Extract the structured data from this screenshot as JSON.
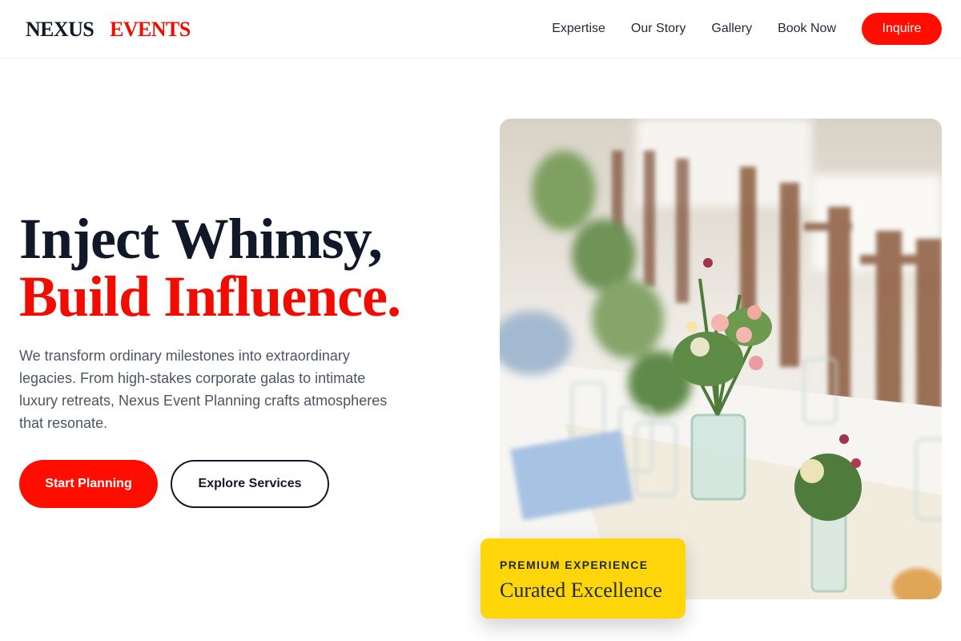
{
  "brand": {
    "word1": "NEXUS",
    "word2": "EVENTS"
  },
  "nav": {
    "links": [
      "Expertise",
      "Our Story",
      "Gallery",
      "Book Now"
    ],
    "cta": "Inquire"
  },
  "hero": {
    "headline_line1": "Inject Whimsy,",
    "headline_line2": "Build Influence.",
    "lead": "We transform ordinary milestones into extraordinary legacies. From high-stakes corporate galas to intimate luxury retreats, Nexus Event Planning crafts atmospheres that resonate.",
    "primary_button": "Start Planning",
    "secondary_button": "Explore Services",
    "image_icon": "wedding-table-flowers-photo"
  },
  "badge": {
    "kicker": "PREMIUM EXPERIENCE",
    "title": "Curated Excellence"
  },
  "colors": {
    "accent": "#ff0d00",
    "dark": "#111827",
    "badge": "#ffd60a"
  }
}
